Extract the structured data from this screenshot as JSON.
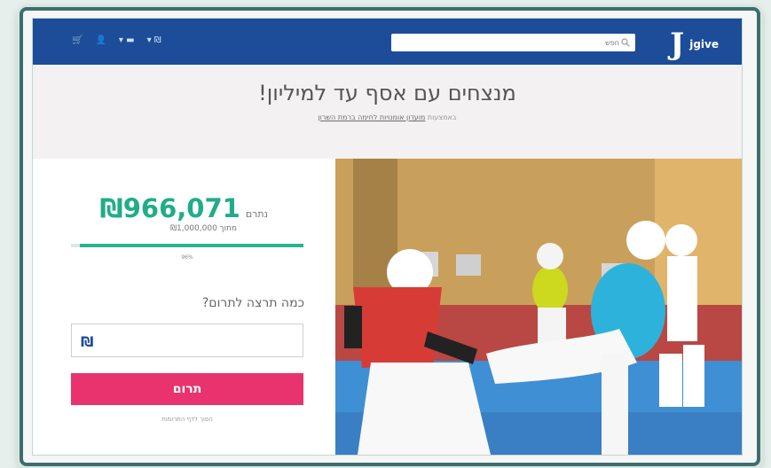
{
  "header": {
    "logo_mark": "J",
    "logo_text": "jgive",
    "search_placeholder": "חפש",
    "nav": {
      "cart": "🛒",
      "user": "👤",
      "lang": "▾ ▬",
      "currency": "▾ ₪"
    }
  },
  "campaign": {
    "title": "מנצחים עם אסף עד למיליון!",
    "org_prefix": "באמצעות",
    "org_name": "מועדון אומנויות לחימה ברמת השרון"
  },
  "donation": {
    "raised_label": "נתרם",
    "raised_amount": "₪966,071",
    "goal_text": "מתוך ₪1,000,000",
    "progress_percent": 96,
    "progress_label": "96%",
    "ask": "כמה תרצה לתרום?",
    "currency_symbol": "₪",
    "amount_value": "",
    "donate_label": "תרום",
    "donors_link": "הפוך לדף התרומות"
  },
  "colors": {
    "header": "#1d4d99",
    "accent_green": "#20ad87",
    "donate": "#e8336e"
  }
}
